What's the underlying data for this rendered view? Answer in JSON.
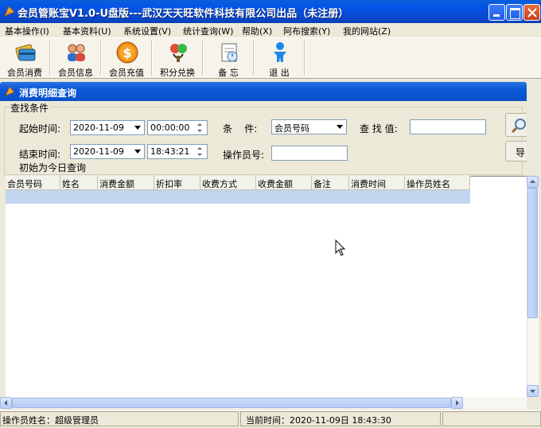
{
  "window": {
    "title": "会员管账宝V1.0-U盘版---武汉天天旺软件科技有限公司出品（未注册）"
  },
  "menu": [
    "基本操作(I)",
    "基本资料(U)",
    "系统设置(V)",
    "统计查询(W)",
    "帮助(X)",
    "阿布搜索(Y)",
    "我的网站(Z)"
  ],
  "toolbar": [
    {
      "label": "会员消费",
      "icon": "card-payment-icon"
    },
    {
      "label": "会员信息",
      "icon": "members-icon"
    },
    {
      "label": "会员充值",
      "icon": "dollar-coin-icon"
    },
    {
      "label": "积分兑换",
      "icon": "points-exchange-icon"
    },
    {
      "label": "备 忘",
      "icon": "memo-icon"
    },
    {
      "label": "退 出",
      "icon": "exit-person-icon"
    }
  ],
  "child_window": {
    "title": "消费明细查询"
  },
  "query": {
    "group_label": "查找条件",
    "start_time_label": "起始时间:",
    "start_date": "2020-11-09",
    "start_time": "00:00:00",
    "end_time_label": "结束时间:",
    "end_date": "2020-11-09",
    "end_time": "18:43:21",
    "condition_label": "条    件:",
    "condition_value": "会员号码",
    "search_value_label": "查 找 值:",
    "search_value": "",
    "operator_no_label": "操作员号:",
    "operator_no": "",
    "init_hint": "初始为今日查询",
    "export_label": "导"
  },
  "table": {
    "columns": [
      "会员号码",
      "姓名",
      "消费金额",
      "折扣率",
      "收费方式",
      "收费金额",
      "备注",
      "消费时间",
      "操作员姓名"
    ],
    "rows": []
  },
  "status": {
    "operator": "操作员姓名：超级管理员",
    "current_time": "当前时间：2020-11-09日 18:43:30"
  },
  "colors": {
    "titlebar": "#0454e8",
    "selection_row": "#c2d5ef",
    "window_bg": "#ece9d8"
  }
}
